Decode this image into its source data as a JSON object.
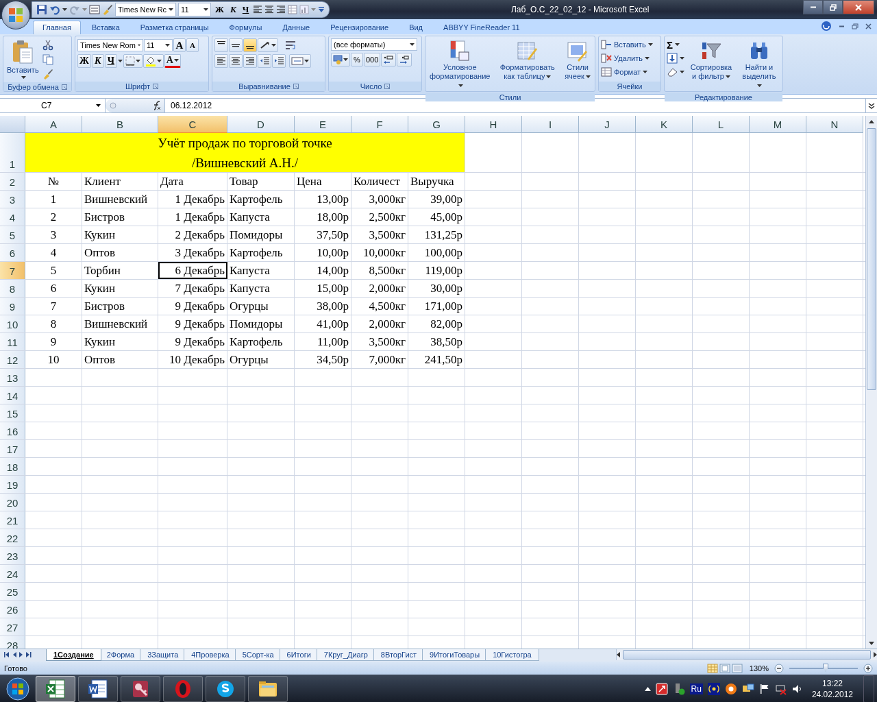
{
  "window": {
    "title": "Лаб_О.С_22_02_12 - Microsoft Excel"
  },
  "quick_access": {
    "font": "Times New Rc",
    "size": "11",
    "bold": "Ж",
    "italic": "К",
    "underline": "Ч"
  },
  "ribbon_tabs": [
    {
      "label": "Главная",
      "selected": true
    },
    {
      "label": "Вставка",
      "selected": false
    },
    {
      "label": "Разметка страницы",
      "selected": false
    },
    {
      "label": "Формулы",
      "selected": false
    },
    {
      "label": "Данные",
      "selected": false
    },
    {
      "label": "Рецензирование",
      "selected": false
    },
    {
      "label": "Вид",
      "selected": false
    },
    {
      "label": "ABBYY FineReader 11",
      "selected": false
    }
  ],
  "clipboard": {
    "title": "Буфер обмена",
    "paste": "Вставить"
  },
  "font": {
    "title": "Шрифт",
    "family": "Times New Rom",
    "size": "11",
    "grow": "A",
    "shrink": "A",
    "bold": "Ж",
    "italic": "К",
    "underline": "Ч",
    "color_button": "A"
  },
  "alignment": {
    "title": "Выравнивание"
  },
  "number": {
    "title": "Число",
    "format": "(все форматы)",
    "percent": "%",
    "thousands": "000"
  },
  "styles": {
    "title": "Стили",
    "buttons": [
      "Условное форматирование",
      "Форматировать как таблицу",
      "Стили ячеек"
    ]
  },
  "cells": {
    "title": "Ячейки",
    "buttons": [
      "Вставить",
      "Удалить",
      "Формат"
    ]
  },
  "editing": {
    "title": "Редактирование",
    "sum": "Σ",
    "buttons": [
      "Сортировка и фильтр",
      "Найти и выделить"
    ]
  },
  "formula_bar": {
    "name_box": "C7",
    "formula": "06.12.2012"
  },
  "sheet": {
    "columns": [
      {
        "label": "A",
        "selected": false
      },
      {
        "label": "B",
        "selected": false
      },
      {
        "label": "C",
        "selected": true
      },
      {
        "label": "D",
        "selected": false
      },
      {
        "label": "E",
        "selected": false
      },
      {
        "label": "F",
        "selected": false
      },
      {
        "label": "G",
        "selected": false
      },
      {
        "label": "H",
        "selected": false
      },
      {
        "label": "I",
        "selected": false
      },
      {
        "label": "J",
        "selected": false
      },
      {
        "label": "K",
        "selected": false
      },
      {
        "label": "L",
        "selected": false
      },
      {
        "label": "M",
        "selected": false
      },
      {
        "label": "N",
        "selected": false
      }
    ],
    "rows": [
      {
        "label": "1",
        "selected": false
      },
      {
        "label": "2",
        "selected": false
      },
      {
        "label": "3",
        "selected": false
      },
      {
        "label": "4",
        "selected": false
      },
      {
        "label": "5",
        "selected": false
      },
      {
        "label": "6",
        "selected": false
      },
      {
        "label": "7",
        "selected": true
      },
      {
        "label": "8",
        "selected": false
      },
      {
        "label": "9",
        "selected": false
      },
      {
        "label": "10",
        "selected": false
      },
      {
        "label": "11",
        "selected": false
      },
      {
        "label": "12",
        "selected": false
      },
      {
        "label": "13",
        "selected": false
      },
      {
        "label": "14",
        "selected": false
      },
      {
        "label": "15",
        "selected": false
      },
      {
        "label": "16",
        "selected": false
      },
      {
        "label": "17",
        "selected": false
      },
      {
        "label": "18",
        "selected": false
      },
      {
        "label": "19",
        "selected": false
      },
      {
        "label": "20",
        "selected": false
      },
      {
        "label": "21",
        "selected": false
      },
      {
        "label": "22",
        "selected": false
      },
      {
        "label": "23",
        "selected": false
      },
      {
        "label": "24",
        "selected": false
      },
      {
        "label": "25",
        "selected": false
      },
      {
        "label": "26",
        "selected": false
      },
      {
        "label": "27",
        "selected": false
      },
      {
        "label": "28",
        "selected": false
      }
    ],
    "title": [
      "Учёт продаж по торговой точке",
      "/Вишневский А.Н./"
    ],
    "header": [
      "№",
      "Клиент",
      "Дата",
      "Товар",
      "Цена",
      "Количест",
      "Выручка"
    ],
    "data": [
      [
        "1",
        "Вишневский",
        "1 Декабрь",
        "Картофель",
        "13,00р",
        "3,000кг",
        "39,00р"
      ],
      [
        "2",
        "Бистров",
        "1 Декабрь",
        "Капуста",
        "18,00р",
        "2,500кг",
        "45,00р"
      ],
      [
        "3",
        "Кукин",
        "2 Декабрь",
        "Помидоры",
        "37,50р",
        "3,500кг",
        "131,25р"
      ],
      [
        "4",
        "Оптов",
        "3 Декабрь",
        "Картофель",
        "10,00р",
        "10,000кг",
        "100,00р"
      ],
      [
        "5",
        "Торбин",
        "6 Декабрь",
        "Капуста",
        "14,00р",
        "8,500кг",
        "119,00р"
      ],
      [
        "6",
        "Кукин",
        "7 Декабрь",
        "Капуста",
        "15,00р",
        "2,000кг",
        "30,00р"
      ],
      [
        "7",
        "Бистров",
        "9 Декабрь",
        "Огурцы",
        "38,00р",
        "4,500кг",
        "171,00р"
      ],
      [
        "8",
        "Вишневский",
        "9 Декабрь",
        "Помидоры",
        "41,00р",
        "2,000кг",
        "82,00р"
      ],
      [
        "9",
        "Кукин",
        "9 Декабрь",
        "Картофель",
        "11,00р",
        "3,500кг",
        "38,50р"
      ],
      [
        "10",
        "Оптов",
        "10 Декабрь",
        "Огурцы",
        "34,50р",
        "7,000кг",
        "241,50р"
      ]
    ]
  },
  "sheet_tabs": [
    {
      "label": "1Создание",
      "selected": true
    },
    {
      "label": "2Форма",
      "selected": false
    },
    {
      "label": "3Защита",
      "selected": false
    },
    {
      "label": "4Проверка",
      "selected": false
    },
    {
      "label": "5Сорт-ка",
      "selected": false
    },
    {
      "label": "6Итоги",
      "selected": false
    },
    {
      "label": "7Круг_Диагр",
      "selected": false
    },
    {
      "label": "8ВторГист",
      "selected": false
    },
    {
      "label": "9ИтогиТовары",
      "selected": false
    },
    {
      "label": "10Гистогра",
      "selected": false
    }
  ],
  "status_bar": {
    "status": "Готово",
    "zoom": "130%",
    "zoom_slider": {
      "level": 0.53
    }
  },
  "taskbar": {
    "apps": [
      {
        "kind": "excel",
        "selected": true
      },
      {
        "kind": "word",
        "selected": false
      },
      {
        "kind": "access",
        "selected": false
      },
      {
        "kind": "opera",
        "selected": false
      },
      {
        "kind": "skype",
        "selected": false
      },
      {
        "kind": "explorer",
        "selected": false
      }
    ],
    "language": "Ru",
    "time": "13:22",
    "date": "24.02.2012"
  }
}
